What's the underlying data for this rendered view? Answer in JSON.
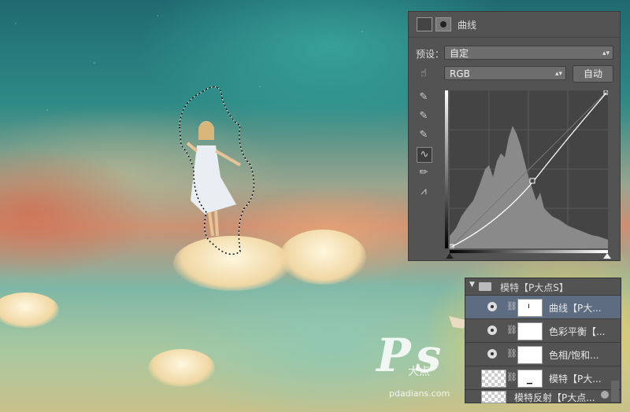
{
  "curves_panel": {
    "title": "曲线",
    "preset_label": "预设：",
    "preset_value": "自定",
    "channel_value": "RGB",
    "auto_button": "自动"
  },
  "layers_panel": {
    "group_name": "模特【P大点S】",
    "layers": [
      {
        "name": "曲线【P大...",
        "selected": true
      },
      {
        "name": "色彩平衡【...",
        "selected": false
      },
      {
        "name": "色相/饱和...",
        "selected": false
      },
      {
        "name": "模特【P大...",
        "selected": false
      },
      {
        "name": "模特反射【P大点...",
        "selected": false
      }
    ]
  },
  "watermark": {
    "logo_text": "Ps",
    "brand": "大点",
    "url": "pdadians.com"
  },
  "colors": {
    "panel_bg": "#535353",
    "selected_layer": "#5d6c80"
  }
}
